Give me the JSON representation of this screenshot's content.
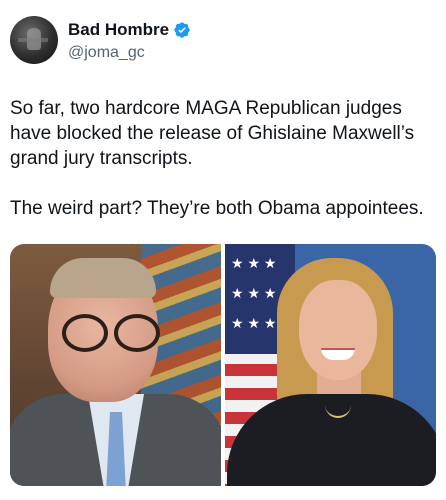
{
  "post": {
    "author": {
      "display_name": "Bad Hombre",
      "handle": "@joma_gc",
      "verified": true,
      "avatar_icon": "profile-photo"
    },
    "text": [
      "So far, two hardcore MAGA Republican judges have blocked the release of Ghislaine Maxwell’s grand jury transcripts.",
      "The weird part? They’re both Obama appointees."
    ],
    "media": [
      {
        "kind": "photo",
        "subject": "man-with-glasses-in-suit"
      },
      {
        "kind": "photo",
        "subject": "woman-with-us-flag-background"
      }
    ]
  },
  "colors": {
    "text": "#0f1419",
    "secondary_text": "#536471",
    "verified_badge": "#1d9bf0"
  }
}
